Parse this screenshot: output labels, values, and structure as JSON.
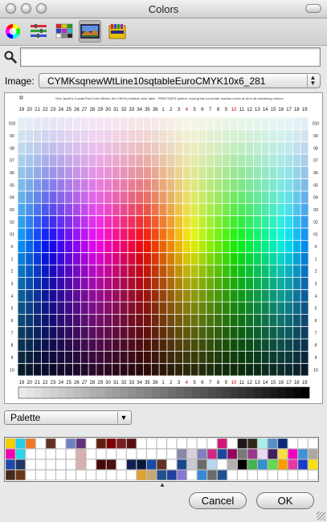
{
  "window": {
    "title": "Colors"
  },
  "toolbar": {
    "tabs": [
      {
        "name": "color-wheel",
        "icon": "color-wheel-icon"
      },
      {
        "name": "sliders",
        "icon": "sliders-icon"
      },
      {
        "name": "palettes",
        "icon": "palettes-icon"
      },
      {
        "name": "image-palettes",
        "icon": "image-palettes-icon",
        "selected": true
      },
      {
        "name": "crayons",
        "icon": "crayons-icon"
      }
    ]
  },
  "search": {
    "value": ""
  },
  "image_select": {
    "label": "Image:",
    "value": "CYMKsqnewWtLine10sqtableEuroCMYK10x6_281"
  },
  "image": {
    "caption": "Dee Jacob's Crystal Fast Color Wheel, the CMYK printable color table - PRINTSAFE system, most great our printer truestar colors at all to all mesaming colours",
    "top_labels": [
      "19",
      "20",
      "21",
      "22",
      "23",
      "24",
      "25",
      "26",
      "27",
      "28",
      "29",
      "30",
      "31",
      "32",
      "33",
      "34",
      "35",
      "36",
      "1",
      "2",
      "3",
      "4",
      "5",
      "6",
      "7",
      "8",
      "9",
      "10",
      "11",
      "12",
      "13",
      "14",
      "15",
      "16",
      "17",
      "18",
      "19"
    ],
    "bottom_labels": [
      "19",
      "20",
      "21",
      "22",
      "23",
      "24",
      "25",
      "26",
      "27",
      "28",
      "29",
      "30",
      "31",
      "32",
      "33",
      "34",
      "35",
      "36",
      "1",
      "2",
      "3",
      "4",
      "5",
      "6",
      "7",
      "8",
      "9",
      "10",
      "11",
      "12",
      "13",
      "14",
      "15",
      "16",
      "17",
      "18",
      "19"
    ],
    "left_labels": [
      "010",
      "09",
      "08",
      "07",
      "06",
      "05",
      "04",
      "03",
      "02",
      "01",
      "0",
      "1",
      "2",
      "3",
      "4",
      "5",
      "6",
      "7",
      "8",
      "9",
      "10"
    ],
    "right_labels": [
      "010",
      "09",
      "08",
      "07",
      "06",
      "05",
      "04",
      "03",
      "02",
      "01",
      "0",
      "1",
      "2",
      "3",
      "4",
      "5",
      "6",
      "7",
      "8",
      "9",
      "10"
    ]
  },
  "mode_select": {
    "value": "Palette"
  },
  "swatches": [
    [
      "#f5d000",
      "#20d0e8",
      "#f07820",
      "",
      "#603020",
      "",
      "#7080c0",
      "#603078",
      "",
      "#602010",
      "#800000",
      "#782020",
      "#581010",
      "",
      "",
      "",
      "",
      "",
      "",
      "",
      "",
      "#d01878",
      "",
      "#201818",
      "#302818",
      "#a8f0e8",
      "#5890c8",
      "#0c2878",
      "",
      "",
      ""
    ],
    [
      "#f000b0",
      "#28d8e8",
      "",
      "",
      "",
      "",
      "",
      "#d8b0b0",
      "",
      "",
      "",
      "",
      "",
      "",
      "",
      "",
      "",
      "#8888a8",
      "#d8d0d8",
      "#8080c0",
      "#d02880",
      "#1848a0",
      "#900060",
      "#787878",
      "#983888",
      "#e8d8f0",
      "#402060",
      "#f8e040",
      "#f000c0",
      "#4090d8",
      "#b0a8a0"
    ],
    [
      "#1a4aa8",
      "#203868",
      "",
      "",
      "",
      "",
      "",
      "#d8b0b0",
      "",
      "#480808",
      "#481010",
      "",
      "#102050",
      "#081838",
      "#1a4aa8",
      "#603020",
      "",
      "#18488c",
      "#c8c8d0",
      "#6a6a6a",
      "#b8d8f0",
      "",
      "#b0b0b0",
      "#000000",
      "#48b050",
      "#3090d0",
      "#60d850",
      "#f8a000",
      "#e838a8",
      "#183cc8",
      "#f8e010"
    ],
    [
      "#482818",
      "#683818",
      "",
      "",
      "",
      "",
      "",
      "",
      "",
      "",
      "",
      "",
      "",
      "#e0a030",
      "#c8a870",
      "#205090",
      "#2040a0",
      "#8878d0",
      "",
      "#3888d8",
      "#6a6a6a",
      "#205090",
      "",
      "",
      "",
      "",
      "",
      "",
      "",
      "",
      ""
    ]
  ],
  "buttons": {
    "cancel": "Cancel",
    "ok": "OK"
  }
}
